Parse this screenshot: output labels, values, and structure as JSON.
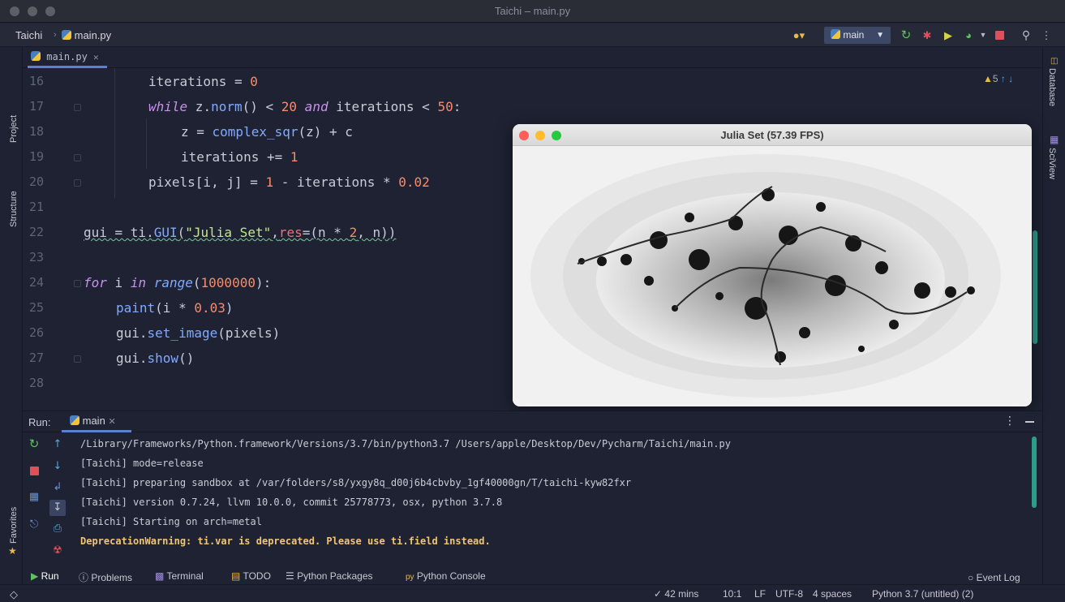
{
  "window": {
    "title": "Taichi – main.py"
  },
  "nav": {
    "project": "Taichi",
    "file": "main.py",
    "run_config": "main"
  },
  "left_tools": {
    "project": "Project",
    "structure": "Structure",
    "favorites": "Favorites"
  },
  "right_tools": {
    "database": "Database",
    "sciview": "SciView"
  },
  "editor_tab": {
    "label": "main.py"
  },
  "inspections": {
    "warnings": "5"
  },
  "code": {
    "line_numbers": [
      "16",
      "17",
      "18",
      "19",
      "20",
      "21",
      "22",
      "23",
      "24",
      "25",
      "26",
      "27",
      "28"
    ],
    "l16": {
      "a": "iterations = ",
      "b": "0"
    },
    "l17": {
      "a": "while",
      "b": " z.",
      "c": "norm",
      "d": "() < ",
      "e": "20",
      "f": " and",
      "g": " iterations < ",
      "h": "50",
      ":": ":"
    },
    "l18": {
      "a": "z = ",
      "b": "complex_sqr",
      "c": "(z) + c"
    },
    "l19": {
      "a": "iterations += ",
      "b": "1"
    },
    "l20": {
      "a": "pixels[i, j] = ",
      "b": "1",
      "c": " - iterations * ",
      "d": "0.02"
    },
    "l22": {
      "a": "gui = ti.",
      "b": "GUI",
      "c": "(",
      "d": "\"Julia Set\"",
      "e": ",",
      "f": "res",
      "g": "=(n * ",
      "h": "2",
      "i": ", n))"
    },
    "l24": {
      "a": "for",
      "b": " i ",
      "c": "in",
      "d": " ",
      "e": "range",
      "f": "(",
      "g": "1000000",
      "h": "):"
    },
    "l25": {
      "a": "paint",
      "b": "(i * ",
      "c": "0.03",
      "d": ")"
    },
    "l26": {
      "a": "gui.",
      "b": "set_image",
      "c": "(pixels)"
    },
    "l27": {
      "a": "gui.",
      "b": "show",
      "c": "()"
    }
  },
  "gui_window": {
    "title": "Julia Set (57.39 FPS)"
  },
  "run_panel": {
    "label": "Run:",
    "tab": "main"
  },
  "console": {
    "lines": [
      "/Library/Frameworks/Python.framework/Versions/3.7/bin/python3.7 /Users/apple/Desktop/Dev/Pycharm/Taichi/main.py",
      "[Taichi] mode=release",
      "[Taichi] preparing sandbox at /var/folders/s8/yxgy8q_d00j6b4cbvby_1gf40000gn/T/taichi-kyw82fxr",
      "[Taichi] version 0.7.24, llvm 10.0.0, commit 25778773, osx, python 3.7.8",
      "[Taichi] Starting on arch=metal",
      "DeprecationWarning: ti.var is deprecated. Please use ti.field instead."
    ]
  },
  "bottom_tabs": {
    "run": "Run",
    "problems": "Problems",
    "terminal": "Terminal",
    "todo": "TODO",
    "packages": "Python Packages",
    "console": "Python Console"
  },
  "status": {
    "time": "42 mins",
    "position": "10:1",
    "line_sep": "LF",
    "encoding": "UTF-8",
    "indent": "4 spaces",
    "interpreter": "Python 3.7 (untitled) (2)",
    "event_log": "Event Log"
  },
  "colors": {
    "accent": "#5c7fd6",
    "warning": "#f0c674",
    "run_green": "#5fc35f",
    "stop_red": "#e0505a"
  }
}
